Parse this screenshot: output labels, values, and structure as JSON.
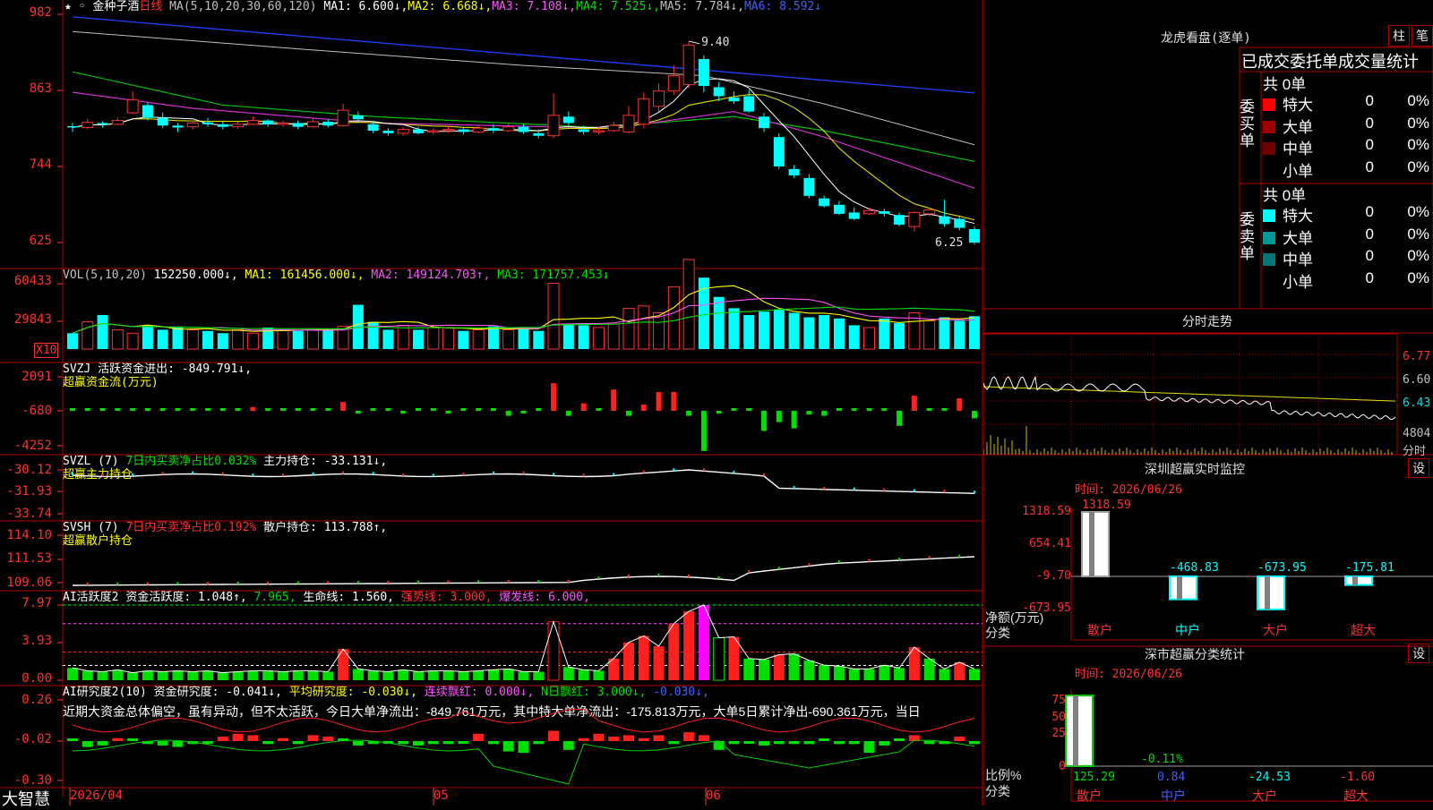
{
  "main_header": {
    "star": "★",
    "glyph": "◦",
    "stock_name": "金种子酒",
    "period": "日线",
    "ma_params": "MA(5,10,20,30,60,120)",
    "ma1": "MA1: 6.600↓,",
    "ma2": "MA2: 6.668↓,",
    "ma3": "MA3: 7.108↓,",
    "ma4": "MA4: 7.525↓,",
    "ma5": "MA5: 7.784↓,",
    "ma6": "MA6: 8.592↓"
  },
  "price_axis": [
    "982",
    "863",
    "744",
    "625"
  ],
  "price_marks": {
    "high": "9.40",
    "low": "6.25"
  },
  "vol_header": {
    "label": "VOL(5,10,20)",
    "value": "152250.000↓,",
    "ma1": "MA1: 161456.000↓,",
    "ma2": "MA2: 149124.703↑,",
    "ma3": "MA3: 171757.453↓"
  },
  "vol_axis": [
    "60433",
    "29843"
  ],
  "vol_unit": "X10",
  "svzj": {
    "header": "SVZJ  活跃资金进出: -849.791↓,",
    "sub": "超赢资金流(万元)",
    "axis": [
      "2091",
      "-680",
      "-4252"
    ]
  },
  "svzl": {
    "h1": "SVZL (7)",
    "h2": "7日内买卖净占比0.032%",
    "h3": "主力持仓: -33.131↓,",
    "sub": "超赢主力持仓",
    "axis": [
      "-30.12",
      "-31.93",
      "-33.74"
    ]
  },
  "svsh": {
    "h1": "SVSH (7)",
    "h2": "7日内买卖净占比0.192%",
    "h3": "散户持仓: 113.788↑,",
    "sub": "超赢散户持仓",
    "axis": [
      "114.10",
      "111.53",
      "109.06"
    ]
  },
  "ai1": {
    "h1": "AI活跃度2",
    "h2": "资金活跃度: 1.048↑,",
    "h3": "7.965,",
    "h4": "生命线: 1.560,",
    "h5": "强势线: 3.000,",
    "h6": "爆发线: 6.000,",
    "axis": [
      "7.97",
      "3.93",
      "0.00"
    ]
  },
  "ai2": {
    "h1": "AI研究度2(10)",
    "h2": "资金研究度: -0.041↓,",
    "h3": "平均研究度: -0.030↓,",
    "h4": "连续飘红: 0.000↓,",
    "h5": "N日飘红: 3.000↓,",
    "h6": "-0.030↓,",
    "comment": "近期大资金总体偏空，虽有异动，但不太活跃，今日大单净流出：-849.761万元，其中特大单净流出：-175.813万元，大单5日累计净出-690.361万元，当日",
    "axis": [
      "0.26",
      "-0.02",
      "-0.30"
    ]
  },
  "bottom_bar": {
    "brand": "大智慧",
    "date1": "2026/04",
    "date2": "05",
    "date3": "06"
  },
  "tiger": {
    "title": "龙虎看盘(逐单)",
    "btn_bar": "柱",
    "btn_pen": "笔",
    "table_title": "已成交委托单成交量统计",
    "buy_label": "委买单",
    "sell_label": "委卖单",
    "buy_total": "共 0单",
    "sell_total": "共 0单",
    "rows_buy": [
      {
        "name": "特大",
        "vol": "0",
        "pct": "0%",
        "color": "#ff0000"
      },
      {
        "name": "大单",
        "vol": "0",
        "pct": "0%",
        "color": "#a00000"
      },
      {
        "name": "中单",
        "vol": "0",
        "pct": "0%",
        "color": "#700000"
      },
      {
        "name": "小单",
        "vol": "0",
        "pct": "0%",
        "color": "#000000"
      }
    ],
    "rows_sell": [
      {
        "name": "特大",
        "vol": "0",
        "pct": "0%",
        "color": "#00ffff"
      },
      {
        "name": "大单",
        "vol": "0",
        "pct": "0%",
        "color": "#009999"
      },
      {
        "name": "中单",
        "vol": "0",
        "pct": "0%",
        "color": "#007777"
      },
      {
        "name": "小单",
        "vol": "0",
        "pct": "0%",
        "color": "#000000"
      }
    ]
  },
  "intraday": {
    "title": "分时走势",
    "axis": [
      "6.77",
      "6.60",
      "6.43"
    ],
    "vol_axis": "4804",
    "vol_label": "分时"
  },
  "sz_monitor": {
    "title": "深圳超赢实时监控",
    "btn": "设",
    "date": "时间: 2026/06/26",
    "axis": [
      "1318.59",
      "654.41",
      "-9.70",
      "-673.95"
    ],
    "axis_label_1": "净额(万元)",
    "axis_label_2": "分类",
    "categories": [
      "散户",
      "中户",
      "大户",
      "超大"
    ],
    "values": [
      1318.59,
      -468.83,
      -673.95,
      -175.81
    ],
    "value_labels": [
      "1318.59",
      "-468.83",
      "-673.95",
      "-175.81"
    ]
  },
  "sz_stats": {
    "title": "深市超赢分类统计",
    "btn": "设",
    "date": "时间: 2026/06/26",
    "axis": [
      "75",
      "50",
      "25",
      "0"
    ],
    "axis_label_1": "比例%",
    "axis_label_2": "分类",
    "categories": [
      "散户",
      "中户",
      "大户",
      "超大"
    ],
    "values": [
      125.29,
      0.84,
      -24.53,
      -1.6
    ],
    "value_labels": [
      "125.29",
      "0.84",
      "-24.53",
      "-1.60"
    ],
    "extra_label": "-0.11%"
  },
  "chart_data": [
    {
      "type": "candlestick",
      "title": "金种子酒 日线",
      "count": 61,
      "x_ticks": [
        "2026/04",
        "05",
        "06"
      ],
      "ohlc": [
        [
          8.07,
          8.05,
          8.12,
          7.98
        ],
        [
          8.05,
          8.13,
          8.18,
          8.02
        ],
        [
          8.12,
          8.1,
          8.15,
          8.05
        ],
        [
          8.1,
          8.16,
          8.2,
          8.08
        ],
        [
          8.28,
          8.48,
          8.62,
          8.26
        ],
        [
          8.4,
          8.2,
          8.44,
          8.16
        ],
        [
          8.2,
          8.08,
          8.28,
          8.04
        ],
        [
          8.08,
          8.05,
          8.12,
          7.98
        ],
        [
          8.06,
          8.12,
          8.16,
          8.02
        ],
        [
          8.13,
          8.1,
          8.2,
          8.06
        ],
        [
          8.1,
          8.06,
          8.14,
          8.02
        ],
        [
          8.06,
          8.1,
          8.14,
          8.03
        ],
        [
          8.1,
          8.16,
          8.22,
          8.08
        ],
        [
          8.16,
          8.1,
          8.18,
          8.06
        ],
        [
          8.1,
          8.12,
          8.16,
          8.06
        ],
        [
          8.12,
          8.06,
          8.16,
          8.02
        ],
        [
          8.06,
          8.14,
          8.2,
          8.04
        ],
        [
          8.14,
          8.08,
          8.18,
          8.05
        ],
        [
          8.08,
          8.32,
          8.42,
          8.06
        ],
        [
          8.24,
          8.18,
          8.3,
          8.12
        ],
        [
          8.1,
          8.0,
          8.14,
          7.96
        ],
        [
          8.0,
          7.96,
          8.04,
          7.92
        ],
        [
          7.96,
          8.02,
          8.06,
          7.92
        ],
        [
          8.02,
          7.96,
          8.06,
          7.94
        ],
        [
          7.98,
          8.0,
          8.04,
          7.94
        ],
        [
          8.0,
          8.02,
          8.08,
          7.96
        ],
        [
          8.02,
          7.98,
          8.06,
          7.94
        ],
        [
          7.98,
          8.04,
          8.08,
          7.96
        ],
        [
          8.04,
          8.0,
          8.1,
          7.96
        ],
        [
          8.0,
          8.06,
          8.12,
          7.98
        ],
        [
          8.06,
          7.98,
          8.1,
          7.95
        ],
        [
          7.96,
          7.92,
          8.02,
          7.88
        ],
        [
          7.92,
          8.24,
          8.58,
          7.88
        ],
        [
          8.22,
          8.12,
          8.3,
          8.08
        ],
        [
          8.02,
          7.98,
          8.08,
          7.94
        ],
        [
          7.98,
          8.0,
          8.06,
          7.94
        ],
        [
          8.0,
          8.08,
          8.14,
          7.98
        ],
        [
          7.98,
          8.24,
          8.38,
          7.96
        ],
        [
          8.1,
          8.5,
          8.6,
          8.04
        ],
        [
          8.38,
          8.62,
          8.74,
          8.3
        ],
        [
          8.62,
          8.86,
          9.02,
          8.56
        ],
        [
          8.72,
          9.34,
          9.4,
          8.66
        ],
        [
          9.12,
          8.7,
          9.18,
          8.6
        ],
        [
          8.68,
          8.54,
          8.76,
          8.46
        ],
        [
          8.52,
          8.46,
          8.62,
          8.42
        ],
        [
          8.54,
          8.3,
          8.64,
          8.28
        ],
        [
          8.22,
          8.04,
          8.28,
          7.98
        ],
        [
          7.9,
          7.44,
          7.96,
          7.4
        ],
        [
          7.4,
          7.3,
          7.46,
          7.26
        ],
        [
          7.26,
          6.98,
          7.32,
          6.94
        ],
        [
          6.94,
          6.82,
          6.98,
          6.8
        ],
        [
          6.84,
          6.7,
          6.9,
          6.68
        ],
        [
          6.72,
          6.62,
          6.8,
          6.6
        ],
        [
          6.7,
          6.75,
          6.8,
          6.68
        ],
        [
          6.74,
          6.7,
          6.78,
          6.66
        ],
        [
          6.68,
          6.53,
          6.72,
          6.5
        ],
        [
          6.5,
          6.72,
          6.74,
          6.42
        ],
        [
          6.7,
          6.76,
          6.8,
          6.66
        ],
        [
          6.66,
          6.54,
          6.92,
          6.5
        ],
        [
          6.62,
          6.48,
          6.66,
          6.44
        ],
        [
          6.46,
          6.25,
          6.5,
          6.22
        ]
      ],
      "ylim": [
        6.25,
        9.82
      ]
    },
    {
      "type": "bar",
      "title": "VOL(5,10,20)",
      "values": [
        14,
        24,
        30,
        17,
        14,
        21,
        17,
        19,
        17,
        16,
        14,
        17,
        14,
        19,
        17,
        16,
        18,
        17,
        20,
        39,
        24,
        17,
        21,
        17,
        19,
        19,
        16,
        17,
        20,
        17,
        19,
        16,
        58,
        22,
        21,
        19,
        22,
        36,
        38,
        32,
        55,
        79,
        63,
        46,
        36,
        30,
        33,
        35,
        32,
        28,
        30,
        27,
        21,
        19,
        27,
        23,
        32,
        25,
        28,
        25,
        29
      ],
      "ylim": [
        0,
        60.433
      ],
      "unit": "X10"
    }
  ]
}
